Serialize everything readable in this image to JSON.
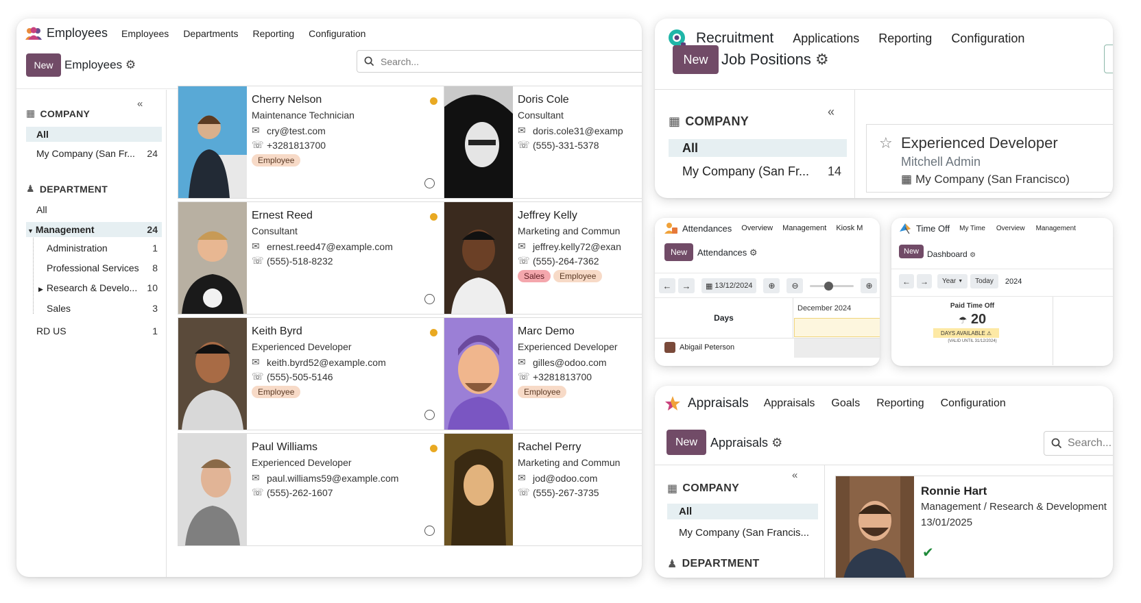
{
  "employees": {
    "app_title": "Employees",
    "menu": [
      "Employees",
      "Departments",
      "Reporting",
      "Configuration"
    ],
    "new_label": "New",
    "breadcrumb": "Employees",
    "search_placeholder": "Search...",
    "company": {
      "title": "COMPANY",
      "items": [
        {
          "label": "All",
          "count": ""
        },
        {
          "label": "My Company (San Fr...",
          "count": "24"
        }
      ]
    },
    "department": {
      "title": "DEPARTMENT",
      "all_label": "All",
      "management": {
        "label": "Management",
        "count": "24"
      },
      "children": [
        {
          "label": "Administration",
          "count": "1"
        },
        {
          "label": "Professional Services",
          "count": "8"
        },
        {
          "label": "Research & Develo...",
          "count": "10"
        },
        {
          "label": "Sales",
          "count": "3"
        }
      ],
      "rd_us": {
        "label": "RD US",
        "count": "1"
      }
    },
    "cards": [
      {
        "name": "Cherry Nelson",
        "job": "Maintenance Technician",
        "email": "cry@test.com",
        "phone": "+3281813700",
        "tags": [
          "Employee"
        ],
        "status": true
      },
      {
        "name": "Doris Cole",
        "job": "Consultant",
        "email": "doris.cole31@examp",
        "phone": "(555)-331-5378",
        "tags": [],
        "status": false
      },
      {
        "name": "Ernest Reed",
        "job": "Consultant",
        "email": "ernest.reed47@example.com",
        "phone": "(555)-518-8232",
        "tags": [],
        "status": true
      },
      {
        "name": "Jeffrey Kelly",
        "job": "Marketing and Commun",
        "email": "jeffrey.kelly72@exan",
        "phone": "(555)-264-7362",
        "tags": [
          "Sales",
          "Employee"
        ],
        "status": false
      },
      {
        "name": "Keith Byrd",
        "job": "Experienced Developer",
        "email": "keith.byrd52@example.com",
        "phone": "(555)-505-5146",
        "tags": [
          "Employee"
        ],
        "status": true
      },
      {
        "name": "Marc Demo",
        "job": "Experienced Developer",
        "email": "gilles@odoo.com",
        "phone": "+3281813700",
        "tags": [
          "Employee"
        ],
        "status": false
      },
      {
        "name": "Paul Williams",
        "job": "Experienced Developer",
        "email": "paul.williams59@example.com",
        "phone": "(555)-262-1607",
        "tags": [],
        "status": true
      },
      {
        "name": "Rachel Perry",
        "job": "Marketing and Commun",
        "email": "jod@odoo.com",
        "phone": "(555)-267-3735",
        "tags": [],
        "status": false
      }
    ]
  },
  "recruitment": {
    "app_title": "Recruitment",
    "menu": [
      "Applications",
      "Reporting",
      "Configuration"
    ],
    "new_label": "New",
    "breadcrumb": "Job Positions",
    "company_title": "COMPANY",
    "all_label": "All",
    "partial_item": "My Company (San Fr...",
    "partial_count": "14",
    "job": {
      "title": "Experienced Developer",
      "manager": "Mitchell Admin",
      "company": "My Company (San Francisco)"
    }
  },
  "attendances": {
    "app_title": "Attendances",
    "menu": [
      "Overview",
      "Management",
      "Kiosk M"
    ],
    "new_label": "New",
    "breadcrumb": "Attendances",
    "date": "13/12/2024",
    "days_label": "Days",
    "month_label": "December 2024",
    "person": "Abigail Peterson"
  },
  "timeoff": {
    "app_title": "Time Off",
    "menu": [
      "My Time",
      "Overview",
      "Management"
    ],
    "new_label": "New",
    "breadcrumb": "Dashboard",
    "year_btn": "Year",
    "today_btn": "Today",
    "year_value": "2024",
    "paid_label": "Paid Time Off",
    "days_value": "20",
    "days_available": "DAYS AVAILABLE",
    "valid_until": "(VALID UNTIL 31/12/2024)"
  },
  "appraisals": {
    "app_title": "Appraisals",
    "menu": [
      "Appraisals",
      "Goals",
      "Reporting",
      "Configuration"
    ],
    "new_label": "New",
    "breadcrumb": "Appraisals",
    "search_placeholder": "Search...",
    "company_title": "COMPANY",
    "all_label": "All",
    "company_item": "My Company (San Francis...",
    "department_title": "DEPARTMENT",
    "person": {
      "name": "Ronnie Hart",
      "dept": "Management / Research & Development",
      "date": "13/01/2025"
    }
  },
  "colors": {
    "brand": "#714b67",
    "status_dot": "#e9a922",
    "tag_employee": "#f7dac7",
    "tag_sales": "#f4a7ad",
    "check": "#1f8a3a"
  }
}
